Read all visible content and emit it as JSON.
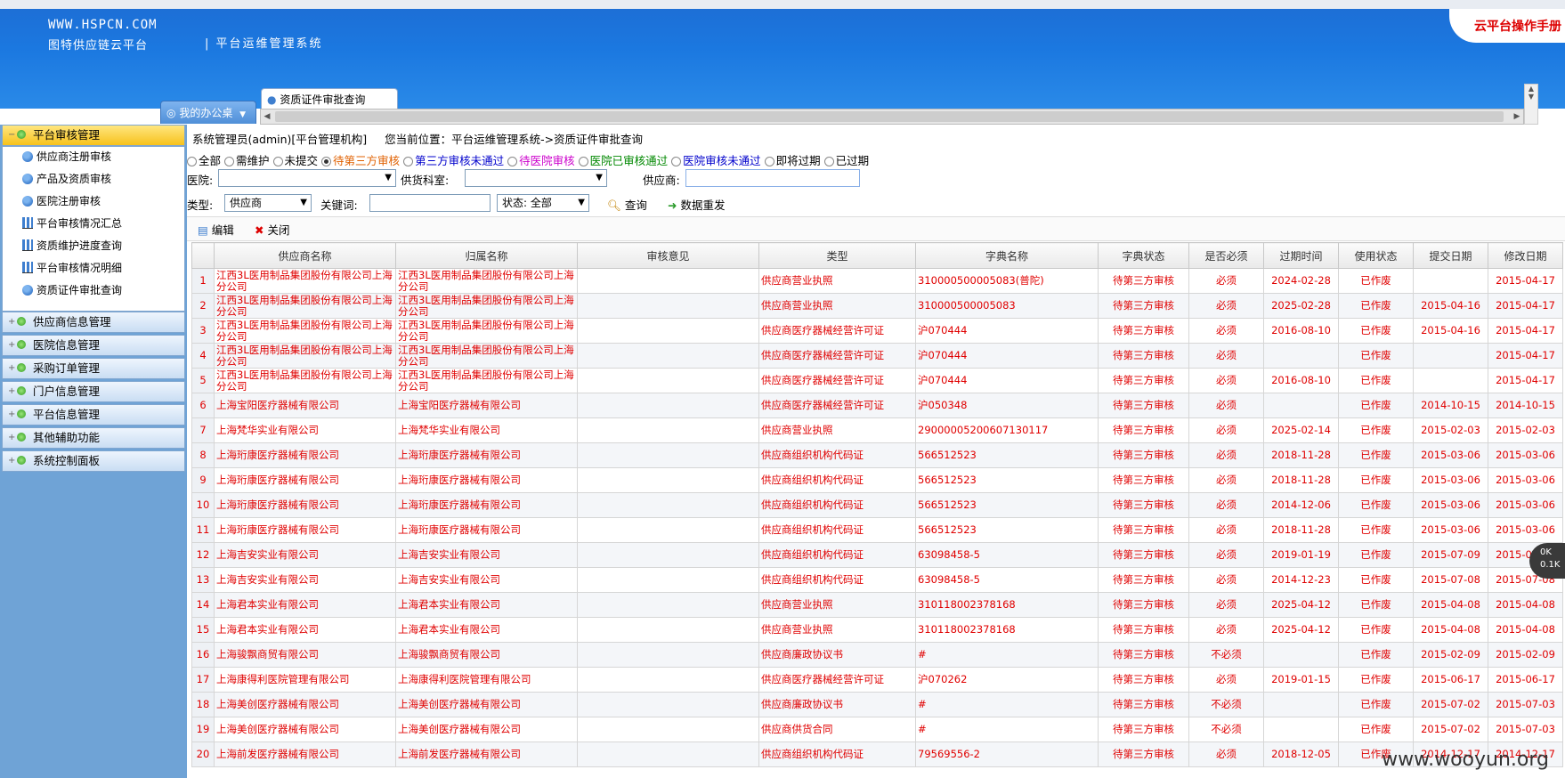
{
  "header": {
    "domain": "WWW.HSPCN.COM",
    "brand": "图特供应链云平台",
    "system_title": "| 平台运维管理系统",
    "manual": "云平台操作手册"
  },
  "tabs": {
    "home": "我的办公桌",
    "active": "资质证件审批查询"
  },
  "sidebar": {
    "groups": [
      {
        "label": "平台审核管理"
      },
      {
        "label": "供应商信息管理"
      },
      {
        "label": "医院信息管理"
      },
      {
        "label": "采购订单管理"
      },
      {
        "label": "门户信息管理"
      },
      {
        "label": "平台信息管理"
      },
      {
        "label": "其他辅助功能"
      },
      {
        "label": "系统控制面板"
      }
    ],
    "subitems": [
      {
        "label": "供应商注册审核",
        "icon": "user-icon"
      },
      {
        "label": "产品及资质审核",
        "icon": "user-icon"
      },
      {
        "label": "医院注册审核",
        "icon": "user-icon"
      },
      {
        "label": "平台审核情况汇总",
        "icon": "chart-icon"
      },
      {
        "label": "资质维护进度查询",
        "icon": "chart-icon"
      },
      {
        "label": "平台审核情况明细",
        "icon": "chart-icon"
      },
      {
        "label": "资质证件审批查询",
        "icon": "user-icon"
      }
    ]
  },
  "crumb": {
    "user": "系统管理员(admin)[平台管理机构]",
    "location": "您当前位置：平台运维管理系统->资质证件审批查询"
  },
  "filters": {
    "radios": [
      {
        "label": "全部",
        "color": "#000000"
      },
      {
        "label": "需维护",
        "color": "#000000"
      },
      {
        "label": "未提交",
        "color": "#000000"
      },
      {
        "label": "待第三方审核",
        "color": "#e06000"
      },
      {
        "label": "第三方审核未通过",
        "color": "#0000cc"
      },
      {
        "label": "待医院审核",
        "color": "#cc00cc"
      },
      {
        "label": "医院已审核通过",
        "color": "#008800"
      },
      {
        "label": "医院审核未通过",
        "color": "#0000cc"
      },
      {
        "label": "即将过期",
        "color": "#000000"
      },
      {
        "label": "已过期",
        "color": "#000000"
      }
    ],
    "hospital_label": "医院:",
    "dept_label": "供货科室:",
    "supplier_label": "供应商:",
    "type_label": "类型:",
    "type_value": "供应商",
    "keyword_label": "关键词:",
    "status_value": "状态: 全部",
    "query_button": "查询",
    "resend_button": "数据重发"
  },
  "toolbar": {
    "edit": "编辑",
    "close": "关闭"
  },
  "table": {
    "headers": [
      "",
      "供应商名称",
      "归属名称",
      "审核意见",
      "类型",
      "字典名称",
      "字典状态",
      "是否必须",
      "过期时间",
      "使用状态",
      "提交日期",
      "修改日期"
    ],
    "rows": [
      [
        "1",
        "江西3L医用制品集团股份有限公司上海分公司",
        "江西3L医用制品集团股份有限公司上海分公司",
        "",
        "供应商营业执照",
        "310000500005083(普陀)",
        "待第三方审核",
        "必须",
        "2024-02-28",
        "已作废",
        "",
        "2015-04-17"
      ],
      [
        "2",
        "江西3L医用制品集团股份有限公司上海分公司",
        "江西3L医用制品集团股份有限公司上海分公司",
        "",
        "供应商营业执照",
        "310000500005083",
        "待第三方审核",
        "必须",
        "2025-02-28",
        "已作废",
        "2015-04-16",
        "2015-04-17"
      ],
      [
        "3",
        "江西3L医用制品集团股份有限公司上海分公司",
        "江西3L医用制品集团股份有限公司上海分公司",
        "",
        "供应商医疗器械经营许可证",
        "沪070444",
        "待第三方审核",
        "必须",
        "2016-08-10",
        "已作废",
        "2015-04-16",
        "2015-04-17"
      ],
      [
        "4",
        "江西3L医用制品集团股份有限公司上海分公司",
        "江西3L医用制品集团股份有限公司上海分公司",
        "",
        "供应商医疗器械经营许可证",
        "沪070444",
        "待第三方审核",
        "必须",
        "",
        "已作废",
        "",
        "2015-04-17"
      ],
      [
        "5",
        "江西3L医用制品集团股份有限公司上海分公司",
        "江西3L医用制品集团股份有限公司上海分公司",
        "",
        "供应商医疗器械经营许可证",
        "沪070444",
        "待第三方审核",
        "必须",
        "2016-08-10",
        "已作废",
        "",
        "2015-04-17"
      ],
      [
        "6",
        "上海宝阳医疗器械有限公司",
        "上海宝阳医疗器械有限公司",
        "",
        "供应商医疗器械经营许可证",
        "沪050348",
        "待第三方审核",
        "必须",
        "",
        "已作废",
        "2014-10-15",
        "2014-10-15"
      ],
      [
        "7",
        "上海梵华实业有限公司",
        "上海梵华实业有限公司",
        "",
        "供应商营业执照",
        "290000052006071301​17",
        "待第三方审核",
        "必须",
        "2025-02-14",
        "已作废",
        "2015-02-03",
        "2015-02-03"
      ],
      [
        "8",
        "上海珩康医疗器械有限公司",
        "上海珩康医疗器械有限公司",
        "",
        "供应商组织机构代码证",
        "566512523",
        "待第三方审核",
        "必须",
        "2018-11-28",
        "已作废",
        "2015-03-06",
        "2015-03-06"
      ],
      [
        "9",
        "上海珩康医疗器械有限公司",
        "上海珩康医疗器械有限公司",
        "",
        "供应商组织机构代码证",
        "566512523",
        "待第三方审核",
        "必须",
        "2018-11-28",
        "已作废",
        "2015-03-06",
        "2015-03-06"
      ],
      [
        "10",
        "上海珩康医疗器械有限公司",
        "上海珩康医疗器械有限公司",
        "",
        "供应商组织机构代码证",
        "566512523",
        "待第三方审核",
        "必须",
        "2014-12-06",
        "已作废",
        "2015-03-06",
        "2015-03-06"
      ],
      [
        "11",
        "上海珩康医疗器械有限公司",
        "上海珩康医疗器械有限公司",
        "",
        "供应商组织机构代码证",
        "566512523",
        "待第三方审核",
        "必须",
        "2018-11-28",
        "已作废",
        "2015-03-06",
        "2015-03-06"
      ],
      [
        "12",
        "上海吉安实业有限公司",
        "上海吉安实业有限公司",
        "",
        "供应商组织机构代码证",
        "63098458-5",
        "待第三方审核",
        "必须",
        "2019-01-19",
        "已作废",
        "2015-07-09",
        "2015-07-09"
      ],
      [
        "13",
        "上海吉安实业有限公司",
        "上海吉安实业有限公司",
        "",
        "供应商组织机构代码证",
        "63098458-5",
        "待第三方审核",
        "必须",
        "2014-12-23",
        "已作废",
        "2015-07-08",
        "2015-07-08"
      ],
      [
        "14",
        "上海君本实业有限公司",
        "上海君本实业有限公司",
        "",
        "供应商营业执照",
        "310118002378168",
        "待第三方审核",
        "必须",
        "2025-04-12",
        "已作废",
        "2015-04-08",
        "2015-04-08"
      ],
      [
        "15",
        "上海君本实业有限公司",
        "上海君本实业有限公司",
        "",
        "供应商营业执照",
        "310118002378168",
        "待第三方审核",
        "必须",
        "2025-04-12",
        "已作废",
        "2015-04-08",
        "2015-04-08"
      ],
      [
        "16",
        "上海骏飘商贸有限公司",
        "上海骏飘商贸有限公司",
        "",
        "供应商廉政协议书",
        "#",
        "待第三方审核",
        "不必须",
        "",
        "已作废",
        "2015-02-09",
        "2015-02-09"
      ],
      [
        "17",
        "上海康得利医院管理有限公司",
        "上海康得利医院管理有限公司",
        "",
        "供应商医疗器械经营许可证",
        "沪070262",
        "待第三方审核",
        "必须",
        "2019-01-15",
        "已作废",
        "2015-06-17",
        "2015-06-17"
      ],
      [
        "18",
        "上海美创医疗器械有限公司",
        "上海美创医疗器械有限公司",
        "",
        "供应商廉政协议书",
        "#",
        "待第三方审核",
        "不必须",
        "",
        "已作废",
        "2015-07-02",
        "2015-07-03"
      ],
      [
        "19",
        "上海美创医疗器械有限公司",
        "上海美创医疗器械有限公司",
        "",
        "供应商供货合同",
        "#",
        "待第三方审核",
        "不必须",
        "",
        "已作废",
        "2015-07-02",
        "2015-07-03"
      ],
      [
        "20",
        "上海前发医疗器械有限公司",
        "上海前发医疗器械有限公司",
        "",
        "供应商组织机构代码证",
        "79569556-2",
        "待第三方审核",
        "必须",
        "2018-12-05",
        "已作废",
        "2014-12-17",
        "2014-12-17"
      ]
    ]
  },
  "overlay": {
    "watermark": "www.wooyun.org",
    "speed_top": "0K",
    "speed_bottom": "0.1K"
  },
  "colors": {
    "header_blue": "#1b78e0",
    "menu_active": "#f7c21c",
    "cell_red": "#e00000"
  }
}
